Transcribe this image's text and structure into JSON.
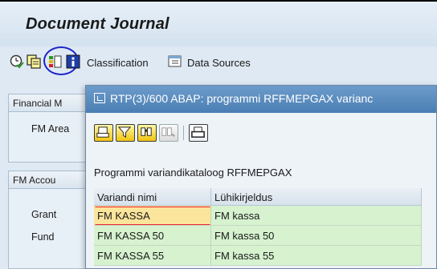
{
  "title": "Document Journal",
  "toolbar": {
    "classification_label": "Classification",
    "data_sources_label": "Data Sources",
    "icons": [
      "execute-icon",
      "get-variant-icon",
      "select-options-icon",
      "info-icon",
      "classification-icon",
      "data-sources-icon"
    ]
  },
  "panels": {
    "financial": {
      "header": "Financial M",
      "field": "FM Area"
    },
    "fm_account": {
      "header": "FM Accou",
      "fields": [
        "Grant",
        "Fund"
      ]
    }
  },
  "dialog": {
    "title": "RTP(3)/600 ABAP: programmi RFFMEPGAX varianc",
    "caption": "Programmi variandikataloog RFFMEPGAX",
    "columns": [
      "Variandi nimi",
      "Lühikirjeldus"
    ],
    "rows": [
      {
        "name": "FM KASSA",
        "desc": "FM kassa",
        "selected": true
      },
      {
        "name": "FM KASSA 50",
        "desc": "FM kassa 50",
        "selected": false
      },
      {
        "name": "FM KASSA 55",
        "desc": "FM kassa 55",
        "selected": false
      }
    ],
    "tools": [
      "choose-icon",
      "filter-icon",
      "find-icon",
      "find-next-icon",
      "print-icon"
    ]
  }
}
